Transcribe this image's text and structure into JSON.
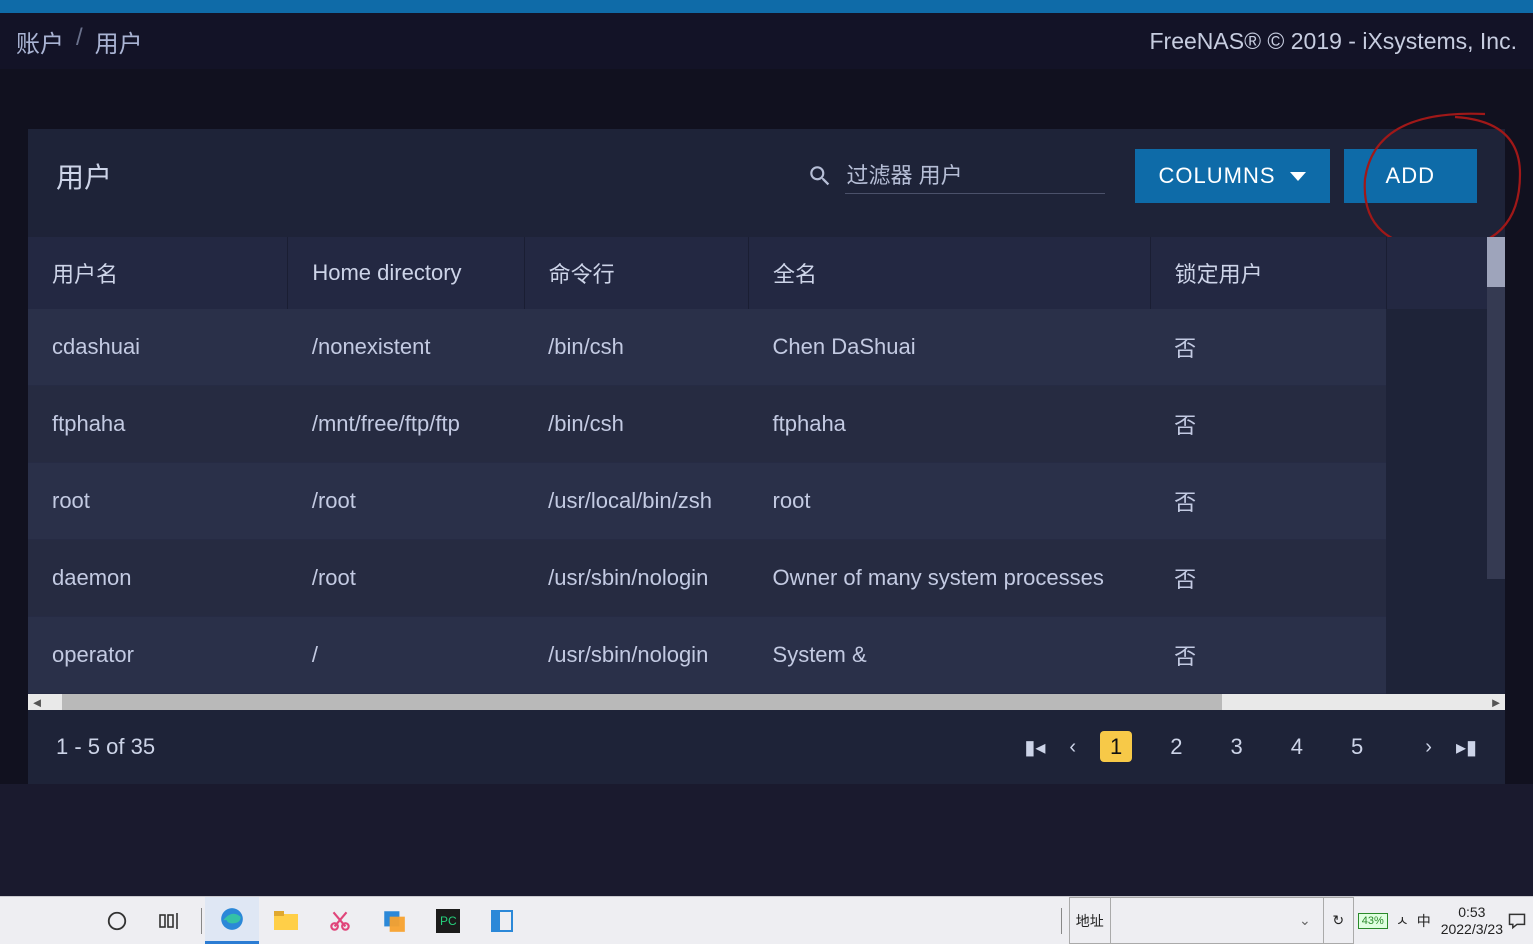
{
  "breadcrumb": {
    "part1": "账户",
    "sep": "/",
    "part2": "用户"
  },
  "copyright": "FreeNAS® © 2019 - iXsystems, Inc.",
  "panel": {
    "title": "用户",
    "filter_placeholder": "过滤器 用户",
    "columns_label": "COLUMNS",
    "add_label": "ADD"
  },
  "table": {
    "headers": [
      "用户名",
      "Home directory",
      "命令行",
      "全名",
      "锁定用户",
      ""
    ],
    "rows": [
      {
        "user": "cdashuai",
        "home": "/nonexistent",
        "shell": "/bin/csh",
        "full": "Chen DaShuai",
        "locked": "否"
      },
      {
        "user": "ftphaha",
        "home": "/mnt/free/ftp/ftp",
        "shell": "/bin/csh",
        "full": "ftphaha",
        "locked": "否"
      },
      {
        "user": "root",
        "home": "/root",
        "shell": "/usr/local/bin/zsh",
        "full": "root",
        "locked": "否"
      },
      {
        "user": "daemon",
        "home": "/root",
        "shell": "/usr/sbin/nologin",
        "full": "Owner of many system processes",
        "locked": "否"
      },
      {
        "user": "operator",
        "home": "/",
        "shell": "/usr/sbin/nologin",
        "full": "System &",
        "locked": "否"
      }
    ]
  },
  "pagination": {
    "status": "1 - 5 of 35",
    "pages": [
      "1",
      "2",
      "3",
      "4",
      "5"
    ],
    "active": 0
  },
  "taskbar": {
    "address_label": "地址",
    "address_dropdown": "⌄",
    "refresh": "↻",
    "battery": "43%",
    "tray_caret": "ㅅ",
    "ime": "中",
    "time": "0:53",
    "date": "2022/3/23"
  }
}
